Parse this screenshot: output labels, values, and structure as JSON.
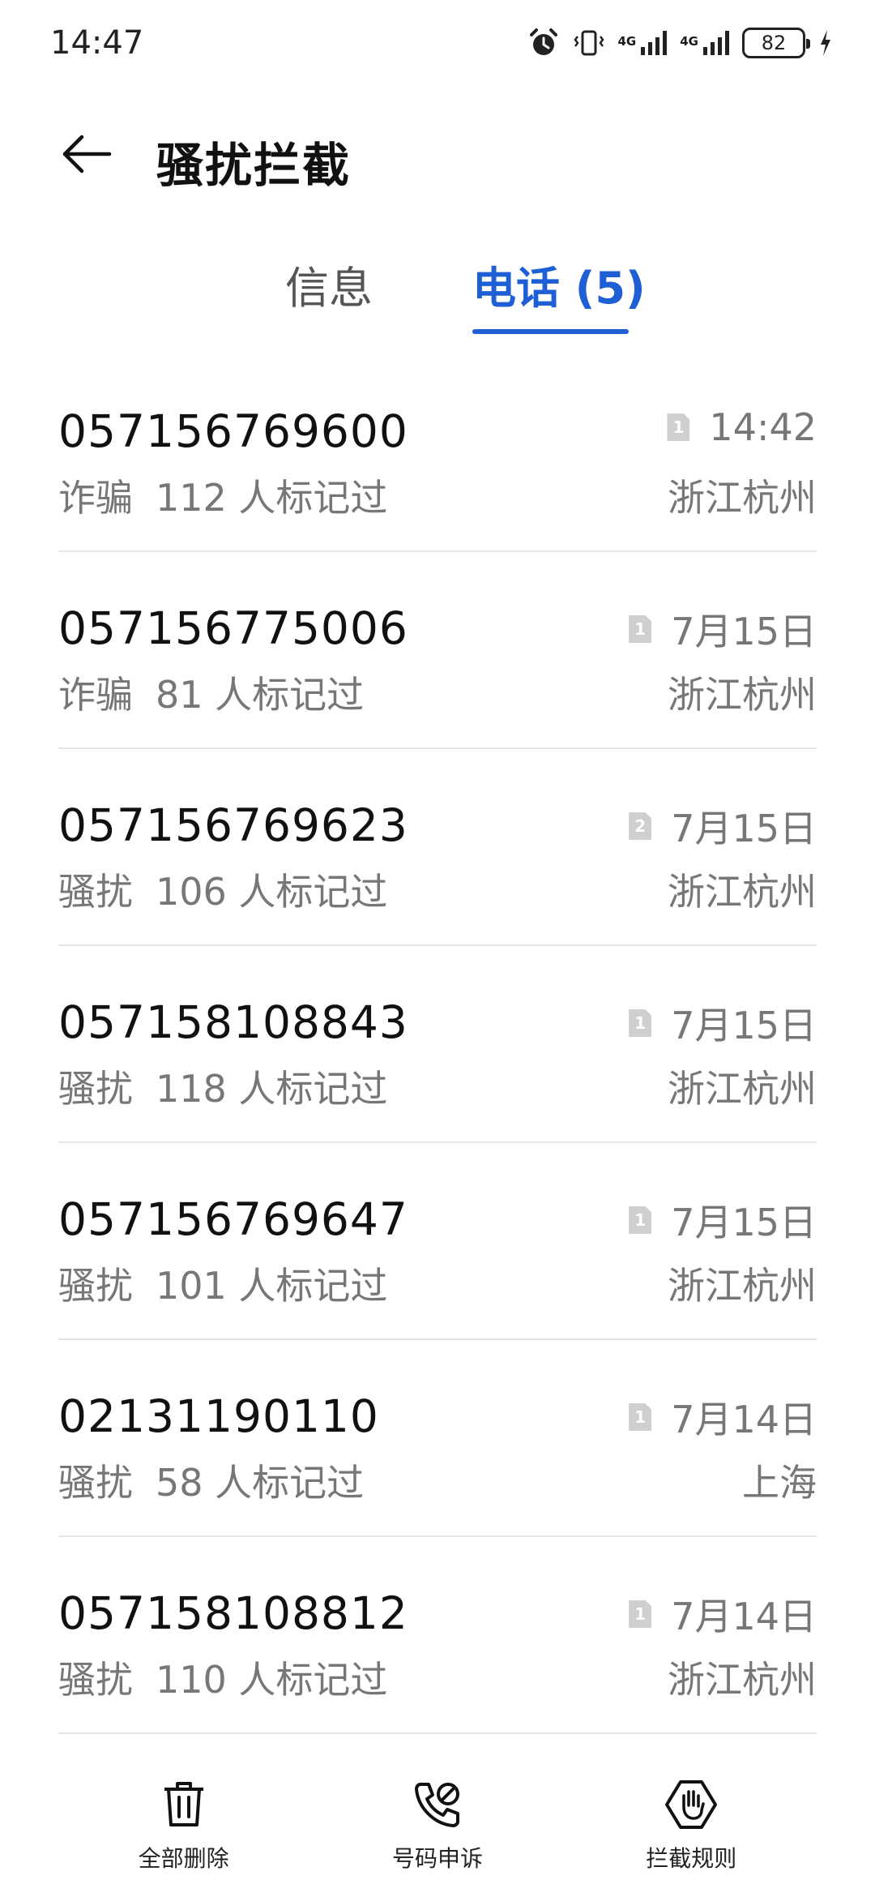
{
  "status_bar": {
    "time": "14:47",
    "signal_tag_1": "4G",
    "signal_tag_2": "4G",
    "battery": "82"
  },
  "header": {
    "title": "骚扰拦截"
  },
  "tabs": [
    {
      "label": "信息",
      "active": false
    },
    {
      "label": "电话 (5)",
      "active": true
    }
  ],
  "calls": [
    {
      "number": "057156769600",
      "tag": "诈骗",
      "count_text": "112 人标记过",
      "sim": "1",
      "time": "14:42",
      "location": "浙江杭州"
    },
    {
      "number": "057156775006",
      "tag": "诈骗",
      "count_text": "81 人标记过",
      "sim": "1",
      "time": "7月15日",
      "location": "浙江杭州"
    },
    {
      "number": "057156769623",
      "tag": "骚扰",
      "count_text": "106 人标记过",
      "sim": "2",
      "time": "7月15日",
      "location": "浙江杭州"
    },
    {
      "number": "057158108843",
      "tag": "骚扰",
      "count_text": "118 人标记过",
      "sim": "1",
      "time": "7月15日",
      "location": "浙江杭州"
    },
    {
      "number": "057156769647",
      "tag": "骚扰",
      "count_text": "101 人标记过",
      "sim": "1",
      "time": "7月15日",
      "location": "浙江杭州"
    },
    {
      "number": "02131190110",
      "tag": "骚扰",
      "count_text": "58 人标记过",
      "sim": "1",
      "time": "7月14日",
      "location": "上海"
    },
    {
      "number": "057158108812",
      "tag": "骚扰",
      "count_text": "110 人标记过",
      "sim": "1",
      "time": "7月14日",
      "location": "浙江杭州"
    }
  ],
  "bottom_bar": {
    "delete_all": "全部删除",
    "number_appeal": "号码申诉",
    "block_rules": "拦截规则"
  },
  "colors": {
    "accent": "#1f5fd6",
    "secondary_text": "#777777",
    "divider": "#e6e6e6"
  },
  "icons": [
    "alarm-icon",
    "vibrate-icon",
    "signal-icon",
    "battery-icon",
    "charging-icon",
    "back-arrow-icon",
    "sim-card-icon",
    "trash-icon",
    "phone-appeal-icon",
    "hand-stop-icon"
  ]
}
